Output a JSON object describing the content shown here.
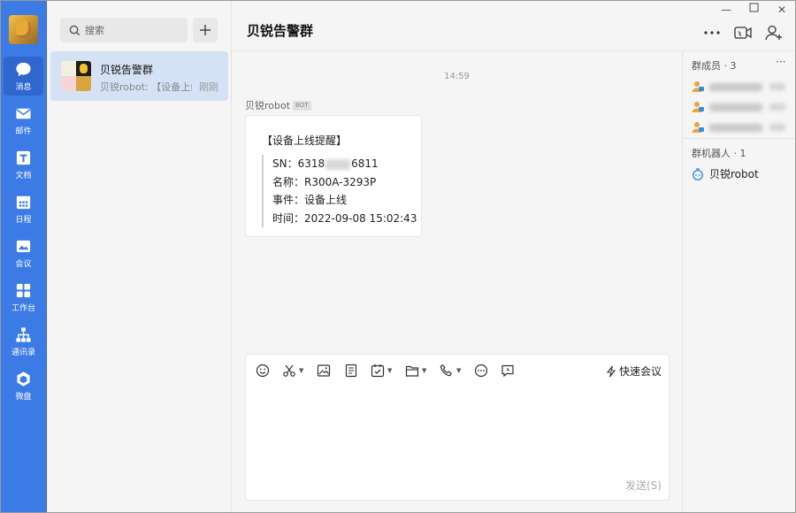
{
  "nav": {
    "items": [
      {
        "label": "消息",
        "icon": "chat-bubble-icon"
      },
      {
        "label": "邮件",
        "icon": "mail-icon"
      },
      {
        "label": "文档",
        "icon": "document-icon"
      },
      {
        "label": "日程",
        "icon": "calendar-icon"
      },
      {
        "label": "会议",
        "icon": "meeting-icon"
      },
      {
        "label": "工作台",
        "icon": "grid-icon"
      },
      {
        "label": "通讯录",
        "icon": "org-chart-icon"
      },
      {
        "label": "微盘",
        "icon": "cloud-disk-icon"
      }
    ]
  },
  "list": {
    "search_placeholder": "搜索",
    "conversations": [
      {
        "name": "贝锐告警群",
        "preview": "贝锐robot: 【设备上线提醒】",
        "time": "刚刚"
      }
    ]
  },
  "chat": {
    "title": "贝锐告警群",
    "timestamp": "14:59",
    "sender": "贝锐robot",
    "bot_badge": "BOT",
    "message": {
      "title": "【设备上线提醒】",
      "sn_prefix": "SN：6318",
      "sn_suffix": "6811",
      "name_line": "名称：R300A-3293P",
      "event_line": "事件：设备上线",
      "time_line": "时间：2022-09-08 15:02:43"
    }
  },
  "input": {
    "quick_meeting": "快速会议",
    "send_label": "发送(S)"
  },
  "right_panel": {
    "members_title": "群成员 · 3",
    "robots_title": "群机器人 · 1",
    "robot_name": "贝锐robot"
  },
  "colors": {
    "nav_bg": "#3c7be5",
    "selected_conv": "#d5e2f5"
  }
}
